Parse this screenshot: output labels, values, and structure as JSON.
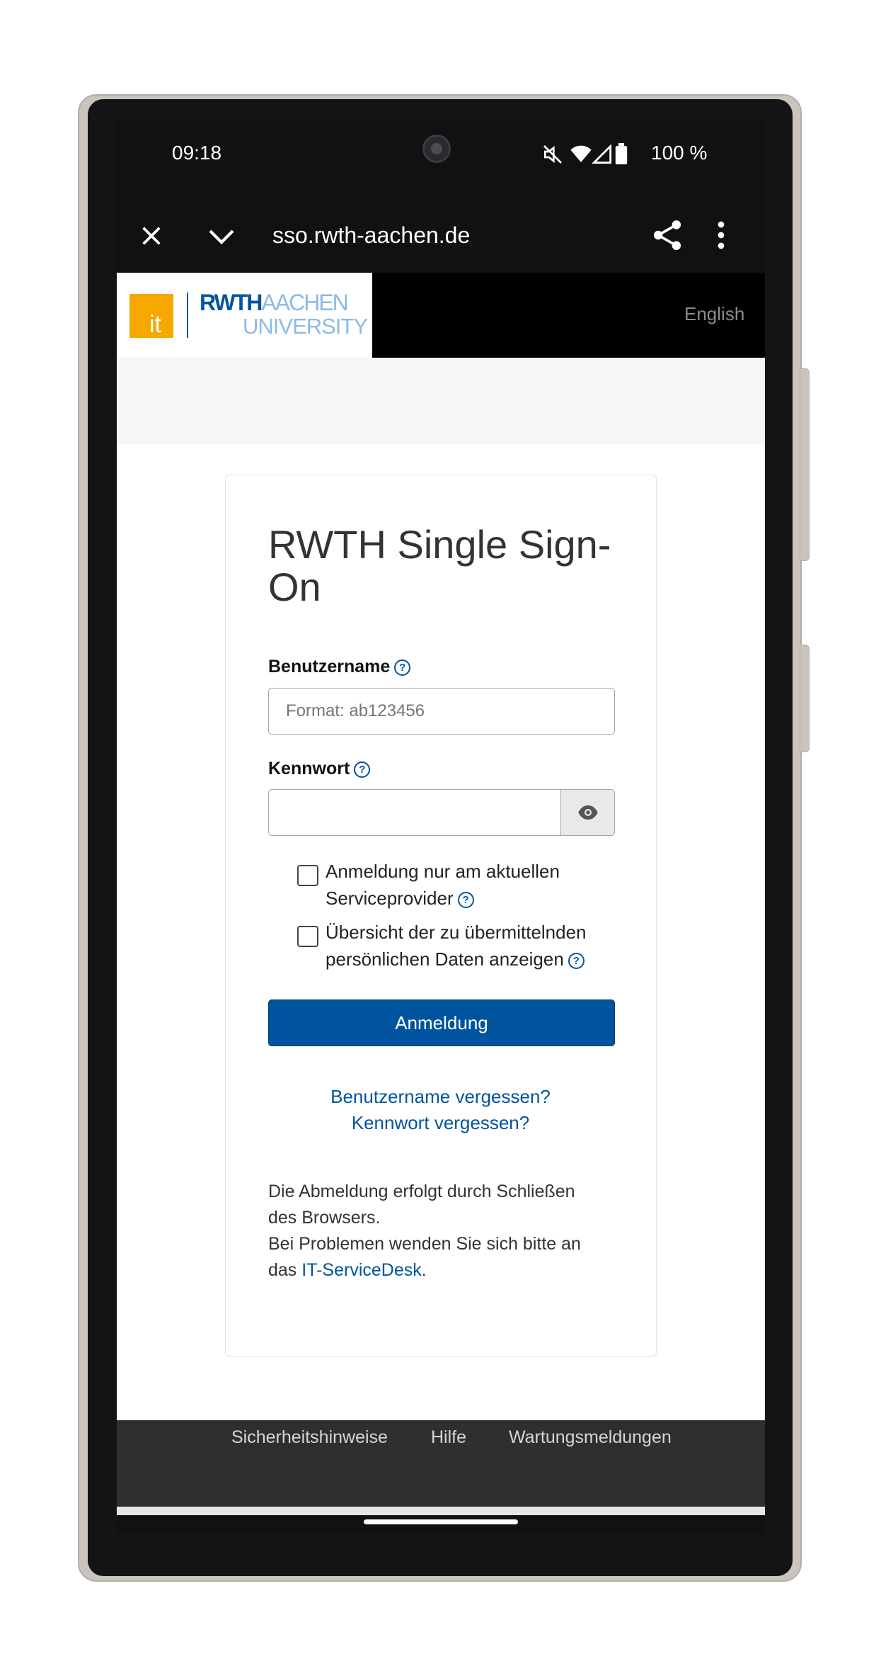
{
  "status_bar": {
    "time": "09:18",
    "battery": "100 %",
    "icons": [
      "mute-icon",
      "wifi-icon",
      "signal-icon",
      "battery-icon"
    ]
  },
  "browser": {
    "url": "sso.rwth-aachen.de",
    "icons": [
      "close-icon",
      "chevron-down-icon",
      "share-icon",
      "more-vert-icon"
    ]
  },
  "header": {
    "logo_it": "it",
    "logo_rwth": "RWTH",
    "logo_aachen": "AACHEN",
    "logo_university": "UNIVERSITY",
    "language": "English"
  },
  "form": {
    "title": "RWTH Single Sign-On",
    "username_label": "Benutzername",
    "username_placeholder": "Format: ab123456",
    "password_label": "Kennwort",
    "checkbox1_line1": "Anmeldung nur am aktuellen",
    "checkbox1_line2": "Serviceprovider",
    "checkbox2_line1": "Übersicht der zu übermittelnden",
    "checkbox2_line2": "persönlichen Daten anzeigen",
    "submit": "Anmeldung",
    "forgot_username": "Benutzername vergessen?",
    "forgot_password": "Kennwort vergessen?",
    "info_line1": "Die Abmeldung erfolgt durch Schließen",
    "info_line2": "des Browsers.",
    "info_line3": "Bei Problemen wenden Sie sich bitte an",
    "info_line4_prefix": "das",
    "info_link": "IT-ServiceDesk",
    "info_line4_suffix": "."
  },
  "footer": {
    "links": [
      "Sicherheitshinweise",
      "Hilfe",
      "Wartungsmeldungen"
    ]
  },
  "colors": {
    "brand_blue": "#00549f",
    "it_orange": "#f6a800",
    "footer_bg": "#2f2f2f"
  }
}
